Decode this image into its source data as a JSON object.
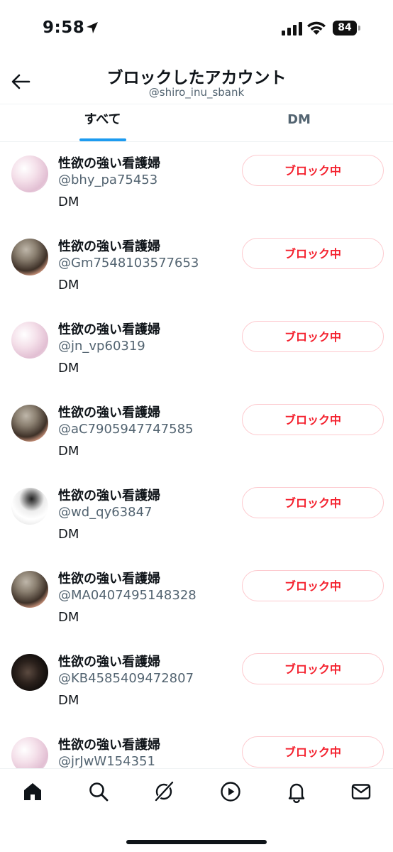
{
  "status_bar": {
    "time": "9:58",
    "battery": "84",
    "icons": [
      "location-arrow-icon",
      "signal-icon",
      "wifi-icon",
      "battery-icon"
    ]
  },
  "header": {
    "title": "ブロックしたアカウント",
    "subtitle": "@shiro_inu_sbank",
    "back_icon": "arrow-left-icon"
  },
  "tabs": [
    {
      "label": "すべて",
      "selected": true
    },
    {
      "label": "DM",
      "selected": false
    }
  ],
  "accent_color": "#1d9bf0",
  "block_color": "#f4212e",
  "accounts": [
    {
      "name": "性欲の強い看護婦",
      "handle": "@bhy_pa75453",
      "type": "DM",
      "button": "ブロック中"
    },
    {
      "name": "性欲の強い看護婦",
      "handle": "@Gm7548103577653",
      "type": "DM",
      "button": "ブロック中"
    },
    {
      "name": "性欲の強い看護婦",
      "handle": "@jn_vp60319",
      "type": "DM",
      "button": "ブロック中"
    },
    {
      "name": "性欲の強い看護婦",
      "handle": "@aC7905947747585",
      "type": "DM",
      "button": "ブロック中"
    },
    {
      "name": "性欲の強い看護婦",
      "handle": "@wd_qy63847",
      "type": "DM",
      "button": "ブロック中"
    },
    {
      "name": "性欲の強い看護婦",
      "handle": "@MA0407495148328",
      "type": "DM",
      "button": "ブロック中"
    },
    {
      "name": "性欲の強い看護婦",
      "handle": "@KB4585409472807",
      "type": "DM",
      "button": "ブロック中"
    },
    {
      "name": "性欲の強い看護婦",
      "handle": "@jrJwW154351",
      "type": "",
      "button": "ブロック中"
    }
  ],
  "bottom_nav": [
    "home-icon",
    "search-icon",
    "grok-icon",
    "video-icon",
    "notifications-bell-icon",
    "messages-envelope-icon"
  ]
}
